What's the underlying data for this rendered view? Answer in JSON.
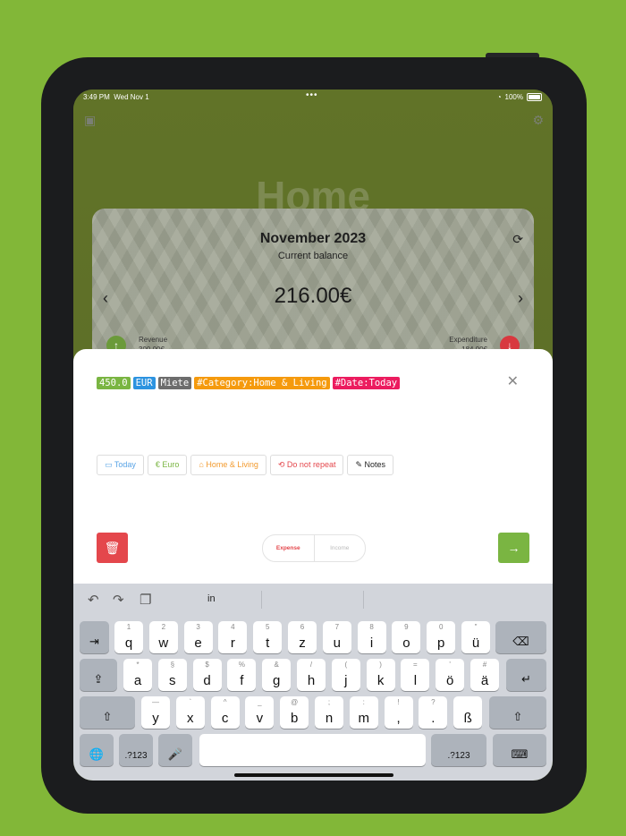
{
  "status_bar": {
    "time": "3:49 PM",
    "date": "Wed Nov 1",
    "dots": "•••",
    "battery": "100%"
  },
  "header": {
    "title": "Home"
  },
  "balance_card": {
    "month": "November 2023",
    "subtitle": "Current balance",
    "balance": "216.00€",
    "revenue_label": "Revenue",
    "revenue_value": "300.00€",
    "expenditure_label": "Expenditure",
    "expenditure_value": "184.00€"
  },
  "entry_sheet": {
    "tags": [
      {
        "text": "450.0",
        "color": "#7ab542"
      },
      {
        "text": "EUR",
        "color": "#2c93e0"
      },
      {
        "text": "Miete",
        "color": "#6d6d6d"
      },
      {
        "text": "#Category:Home & Living",
        "color": "#f59a0d"
      },
      {
        "text": "#Date:Today",
        "color": "#ec1c5f"
      }
    ],
    "chips": [
      {
        "icon": "calendar-icon",
        "glyph": "▭",
        "label": "Today",
        "color": "#5aa4e6"
      },
      {
        "icon": "euro-icon",
        "glyph": "€",
        "label": "Euro",
        "color": "#7ab542"
      },
      {
        "icon": "home-icon",
        "glyph": "⌂",
        "label": "Home & Living",
        "color": "#f29a2e"
      },
      {
        "icon": "repeat-icon",
        "glyph": "⟲",
        "label": "Do not repeat",
        "color": "#e4474c"
      },
      {
        "icon": "pencil-icon",
        "glyph": "✎",
        "label": "Notes",
        "color": "#222222"
      }
    ],
    "type_toggle": {
      "expense": "Expense",
      "income": "Income",
      "selected": "Expense"
    }
  },
  "keyboard": {
    "suggestion": "in",
    "row1": [
      [
        "1",
        "q"
      ],
      [
        "2",
        "w"
      ],
      [
        "3",
        "e"
      ],
      [
        "4",
        "r"
      ],
      [
        "5",
        "t"
      ],
      [
        "6",
        "z"
      ],
      [
        "7",
        "u"
      ],
      [
        "8",
        "i"
      ],
      [
        "9",
        "o"
      ],
      [
        "0",
        "p"
      ],
      [
        "\"",
        "ü"
      ]
    ],
    "row2": [
      [
        "*",
        "a"
      ],
      [
        "§",
        "s"
      ],
      [
        "$",
        "d"
      ],
      [
        "%",
        "f"
      ],
      [
        "&",
        "g"
      ],
      [
        "/",
        "h"
      ],
      [
        "(",
        "j"
      ],
      [
        ")",
        "k"
      ],
      [
        "=",
        "l"
      ],
      [
        "'",
        "ö"
      ],
      [
        "#",
        "ä"
      ]
    ],
    "row3": [
      [
        "—",
        "y"
      ],
      [
        "`",
        "x"
      ],
      [
        "^",
        "c"
      ],
      [
        "_",
        "v"
      ],
      [
        "@",
        "b"
      ],
      [
        ";",
        "n"
      ],
      [
        ":",
        "m"
      ],
      [
        "!",
        ","
      ],
      [
        "?",
        "."
      ],
      [
        "",
        "ß"
      ]
    ],
    "numbers_key": ".?123"
  }
}
